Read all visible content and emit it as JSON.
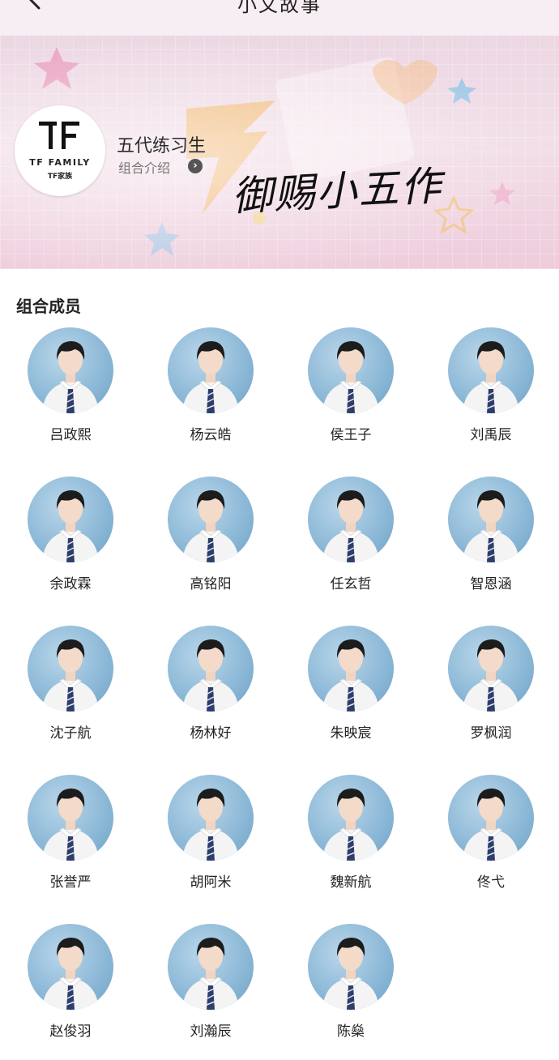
{
  "topbar": {
    "title": "小文故事"
  },
  "banner": {
    "logo_brand": "TF FAMILY",
    "logo_sub": "TF家族",
    "group_name": "五代练习生",
    "group_intro_label": "组合介绍",
    "overlay_text": "御赐小五作"
  },
  "section": {
    "title": "组合成员"
  },
  "members": [
    {
      "name": "吕政熙"
    },
    {
      "name": "杨云皓"
    },
    {
      "name": "侯王子"
    },
    {
      "name": "刘禹辰"
    },
    {
      "name": "余政霖"
    },
    {
      "name": "高铭阳"
    },
    {
      "name": "任玄哲"
    },
    {
      "name": "智恩涵"
    },
    {
      "name": "沈子航"
    },
    {
      "name": "杨林好"
    },
    {
      "name": "朱映宸"
    },
    {
      "name": "罗枫润"
    },
    {
      "name": "张誉严"
    },
    {
      "name": "胡阿米"
    },
    {
      "name": "魏新航"
    },
    {
      "name": "佟弋"
    },
    {
      "name": "赵俊羽"
    },
    {
      "name": "刘瀚辰"
    },
    {
      "name": "陈燊"
    }
  ],
  "colors": {
    "avatar_bg": "#8ab7d6",
    "banner_bg": "#eed7e3",
    "topbar_bg": "#f7eef3"
  }
}
